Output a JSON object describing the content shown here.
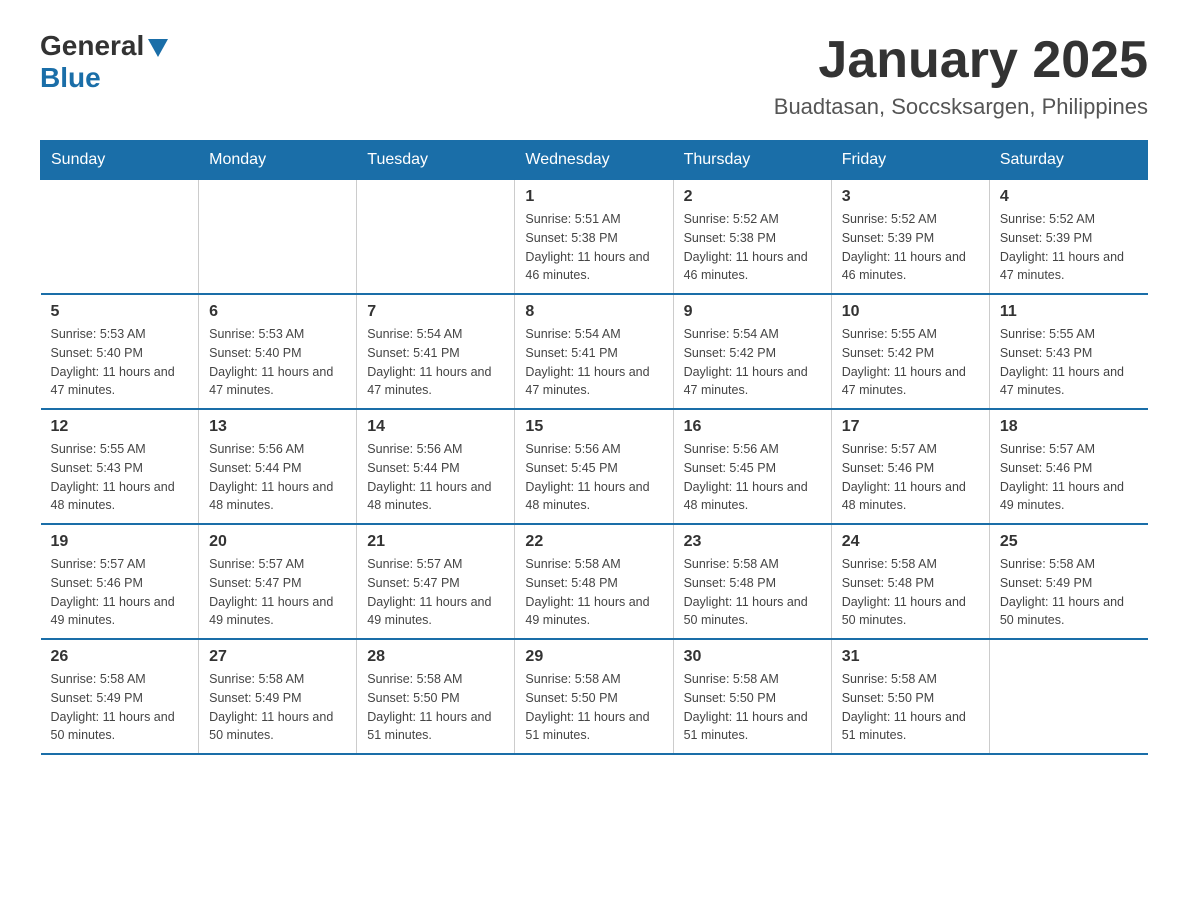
{
  "header": {
    "logo_general": "General",
    "logo_blue": "Blue",
    "month_title": "January 2025",
    "location": "Buadtasan, Soccsksargen, Philippines"
  },
  "weekdays": [
    "Sunday",
    "Monday",
    "Tuesday",
    "Wednesday",
    "Thursday",
    "Friday",
    "Saturday"
  ],
  "weeks": [
    [
      {
        "day": "",
        "info": ""
      },
      {
        "day": "",
        "info": ""
      },
      {
        "day": "",
        "info": ""
      },
      {
        "day": "1",
        "info": "Sunrise: 5:51 AM\nSunset: 5:38 PM\nDaylight: 11 hours and 46 minutes."
      },
      {
        "day": "2",
        "info": "Sunrise: 5:52 AM\nSunset: 5:38 PM\nDaylight: 11 hours and 46 minutes."
      },
      {
        "day": "3",
        "info": "Sunrise: 5:52 AM\nSunset: 5:39 PM\nDaylight: 11 hours and 46 minutes."
      },
      {
        "day": "4",
        "info": "Sunrise: 5:52 AM\nSunset: 5:39 PM\nDaylight: 11 hours and 47 minutes."
      }
    ],
    [
      {
        "day": "5",
        "info": "Sunrise: 5:53 AM\nSunset: 5:40 PM\nDaylight: 11 hours and 47 minutes."
      },
      {
        "day": "6",
        "info": "Sunrise: 5:53 AM\nSunset: 5:40 PM\nDaylight: 11 hours and 47 minutes."
      },
      {
        "day": "7",
        "info": "Sunrise: 5:54 AM\nSunset: 5:41 PM\nDaylight: 11 hours and 47 minutes."
      },
      {
        "day": "8",
        "info": "Sunrise: 5:54 AM\nSunset: 5:41 PM\nDaylight: 11 hours and 47 minutes."
      },
      {
        "day": "9",
        "info": "Sunrise: 5:54 AM\nSunset: 5:42 PM\nDaylight: 11 hours and 47 minutes."
      },
      {
        "day": "10",
        "info": "Sunrise: 5:55 AM\nSunset: 5:42 PM\nDaylight: 11 hours and 47 minutes."
      },
      {
        "day": "11",
        "info": "Sunrise: 5:55 AM\nSunset: 5:43 PM\nDaylight: 11 hours and 47 minutes."
      }
    ],
    [
      {
        "day": "12",
        "info": "Sunrise: 5:55 AM\nSunset: 5:43 PM\nDaylight: 11 hours and 48 minutes."
      },
      {
        "day": "13",
        "info": "Sunrise: 5:56 AM\nSunset: 5:44 PM\nDaylight: 11 hours and 48 minutes."
      },
      {
        "day": "14",
        "info": "Sunrise: 5:56 AM\nSunset: 5:44 PM\nDaylight: 11 hours and 48 minutes."
      },
      {
        "day": "15",
        "info": "Sunrise: 5:56 AM\nSunset: 5:45 PM\nDaylight: 11 hours and 48 minutes."
      },
      {
        "day": "16",
        "info": "Sunrise: 5:56 AM\nSunset: 5:45 PM\nDaylight: 11 hours and 48 minutes."
      },
      {
        "day": "17",
        "info": "Sunrise: 5:57 AM\nSunset: 5:46 PM\nDaylight: 11 hours and 48 minutes."
      },
      {
        "day": "18",
        "info": "Sunrise: 5:57 AM\nSunset: 5:46 PM\nDaylight: 11 hours and 49 minutes."
      }
    ],
    [
      {
        "day": "19",
        "info": "Sunrise: 5:57 AM\nSunset: 5:46 PM\nDaylight: 11 hours and 49 minutes."
      },
      {
        "day": "20",
        "info": "Sunrise: 5:57 AM\nSunset: 5:47 PM\nDaylight: 11 hours and 49 minutes."
      },
      {
        "day": "21",
        "info": "Sunrise: 5:57 AM\nSunset: 5:47 PM\nDaylight: 11 hours and 49 minutes."
      },
      {
        "day": "22",
        "info": "Sunrise: 5:58 AM\nSunset: 5:48 PM\nDaylight: 11 hours and 49 minutes."
      },
      {
        "day": "23",
        "info": "Sunrise: 5:58 AM\nSunset: 5:48 PM\nDaylight: 11 hours and 50 minutes."
      },
      {
        "day": "24",
        "info": "Sunrise: 5:58 AM\nSunset: 5:48 PM\nDaylight: 11 hours and 50 minutes."
      },
      {
        "day": "25",
        "info": "Sunrise: 5:58 AM\nSunset: 5:49 PM\nDaylight: 11 hours and 50 minutes."
      }
    ],
    [
      {
        "day": "26",
        "info": "Sunrise: 5:58 AM\nSunset: 5:49 PM\nDaylight: 11 hours and 50 minutes."
      },
      {
        "day": "27",
        "info": "Sunrise: 5:58 AM\nSunset: 5:49 PM\nDaylight: 11 hours and 50 minutes."
      },
      {
        "day": "28",
        "info": "Sunrise: 5:58 AM\nSunset: 5:50 PM\nDaylight: 11 hours and 51 minutes."
      },
      {
        "day": "29",
        "info": "Sunrise: 5:58 AM\nSunset: 5:50 PM\nDaylight: 11 hours and 51 minutes."
      },
      {
        "day": "30",
        "info": "Sunrise: 5:58 AM\nSunset: 5:50 PM\nDaylight: 11 hours and 51 minutes."
      },
      {
        "day": "31",
        "info": "Sunrise: 5:58 AM\nSunset: 5:50 PM\nDaylight: 11 hours and 51 minutes."
      },
      {
        "day": "",
        "info": ""
      }
    ]
  ]
}
